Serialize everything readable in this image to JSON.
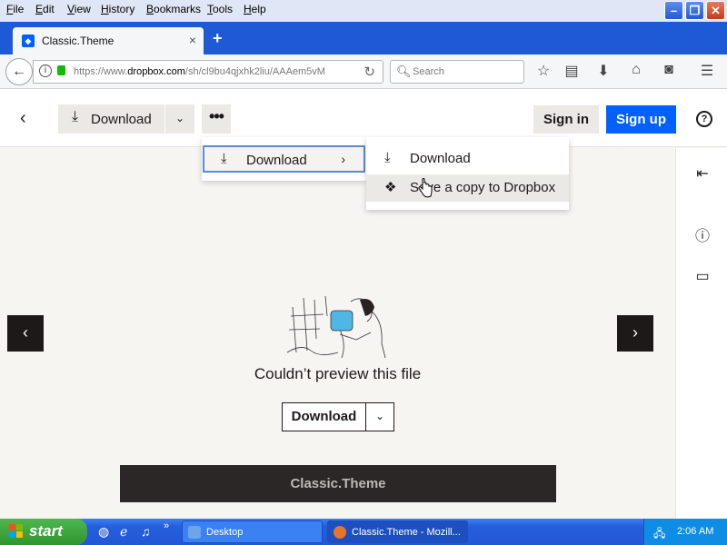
{
  "menubar": {
    "items": [
      {
        "key": "F",
        "rest": "ile"
      },
      {
        "key": "E",
        "rest": "dit"
      },
      {
        "key": "V",
        "rest": "iew"
      },
      {
        "key": "H",
        "rest": "istory"
      },
      {
        "key": "B",
        "rest": "ookmarks"
      },
      {
        "key": "T",
        "rest": "ools"
      },
      {
        "key": "H",
        "rest": "elp"
      }
    ]
  },
  "window_buttons": {
    "minimize": "–",
    "maximize": "❐",
    "close": "✕"
  },
  "tab": {
    "title": "Classic.Theme",
    "close": "×",
    "new_tab": "+"
  },
  "navbar": {
    "url_prefix": "https://www.",
    "url_domain": "dropbox.com",
    "url_rest": "/sh/cl9bu4qjxhk2liu/AAAem5vM",
    "search_placeholder": "Search"
  },
  "page": {
    "download_label": "Download",
    "sign_in": "Sign in",
    "sign_up": "Sign up",
    "help": "?",
    "message": "Couldn’t preview this file",
    "center_download": "Download",
    "filename": "Classic.Theme"
  },
  "menu": {
    "download_label": "Download",
    "submenu": {
      "download": "Download",
      "save_copy": "Save a copy to Dropbox"
    }
  },
  "taskbar": {
    "start": "start",
    "tasks": [
      {
        "label": "Desktop"
      },
      {
        "label": "Classic.Theme - Mozill..."
      }
    ],
    "time": "2:06 AM"
  },
  "colors": {
    "dropbox_blue": "#0061fe",
    "xp_title": "#1f5ad6",
    "page_bg": "#f7f5f2"
  }
}
